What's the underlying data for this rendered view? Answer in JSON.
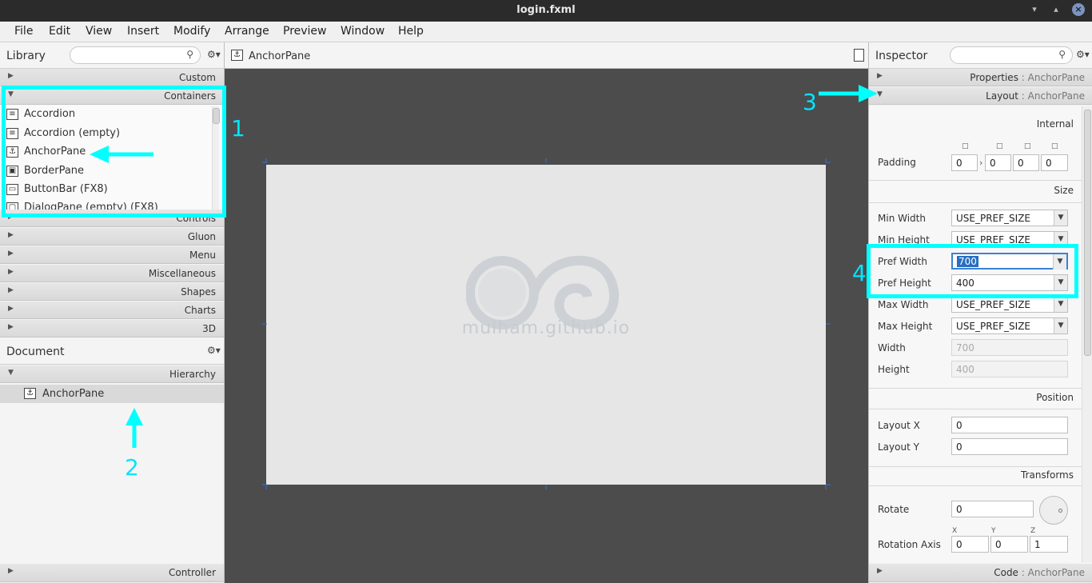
{
  "window": {
    "title": "login.fxml"
  },
  "menu": [
    "File",
    "Edit",
    "View",
    "Insert",
    "Modify",
    "Arrange",
    "Preview",
    "Window",
    "Help"
  ],
  "library": {
    "title": "Library",
    "sections_top": [
      {
        "label": "Custom",
        "expanded": false
      },
      {
        "label": "Containers",
        "expanded": true
      }
    ],
    "items": [
      "Accordion",
      "Accordion  (empty)",
      "AnchorPane",
      "BorderPane",
      "ButtonBar  (FX8)",
      "DialogPane (empty)  (FX8)"
    ],
    "sections_bottom": [
      "Controls",
      "Gluon",
      "Menu",
      "Miscellaneous",
      "Shapes",
      "Charts",
      "3D"
    ]
  },
  "document": {
    "title": "Document",
    "hierarchy_label": "Hierarchy",
    "root": "AnchorPane",
    "controller_label": "Controller"
  },
  "center": {
    "selected": "AnchorPane",
    "watermark": "mulham.github.io"
  },
  "inspector": {
    "title": "Inspector",
    "properties": {
      "label": "Properties",
      "target": "AnchorPane"
    },
    "layout": {
      "label": "Layout",
      "target": "AnchorPane"
    },
    "code": {
      "label": "Code",
      "target": "AnchorPane"
    },
    "internal_label": "Internal",
    "padding_label": "Padding",
    "padding": [
      "0",
      "0",
      "0",
      "0"
    ],
    "size_label": "Size",
    "min_width_label": "Min Width",
    "min_width": "USE_PREF_SIZE",
    "min_height_label": "Min Height",
    "min_height": "USE_PREF_SIZE",
    "pref_width_label": "Pref Width",
    "pref_width": "700",
    "pref_height_label": "Pref Height",
    "pref_height": "400",
    "max_width_label": "Max Width",
    "max_width": "USE_PREF_SIZE",
    "max_height_label": "Max Height",
    "max_height": "USE_PREF_SIZE",
    "width_label": "Width",
    "width": "700",
    "height_label": "Height",
    "height": "400",
    "position_label": "Position",
    "layout_x_label": "Layout X",
    "layout_x": "0",
    "layout_y_label": "Layout Y",
    "layout_y": "0",
    "transforms_label": "Transforms",
    "rotate_label": "Rotate",
    "rotate": "0",
    "rotation_axis_label": "Rotation Axis",
    "axis_labels": [
      "X",
      "Y",
      "Z"
    ],
    "rotation_axis": [
      "0",
      "0",
      "1"
    ],
    "separator": ":"
  },
  "annotations": [
    "1",
    "2",
    "3",
    "4"
  ],
  "colors": {
    "highlight": "#00ffff",
    "titlebar": "#2b2b2b",
    "canvas_bg": "#4c4c4c",
    "selection": "#2a6fbf"
  }
}
